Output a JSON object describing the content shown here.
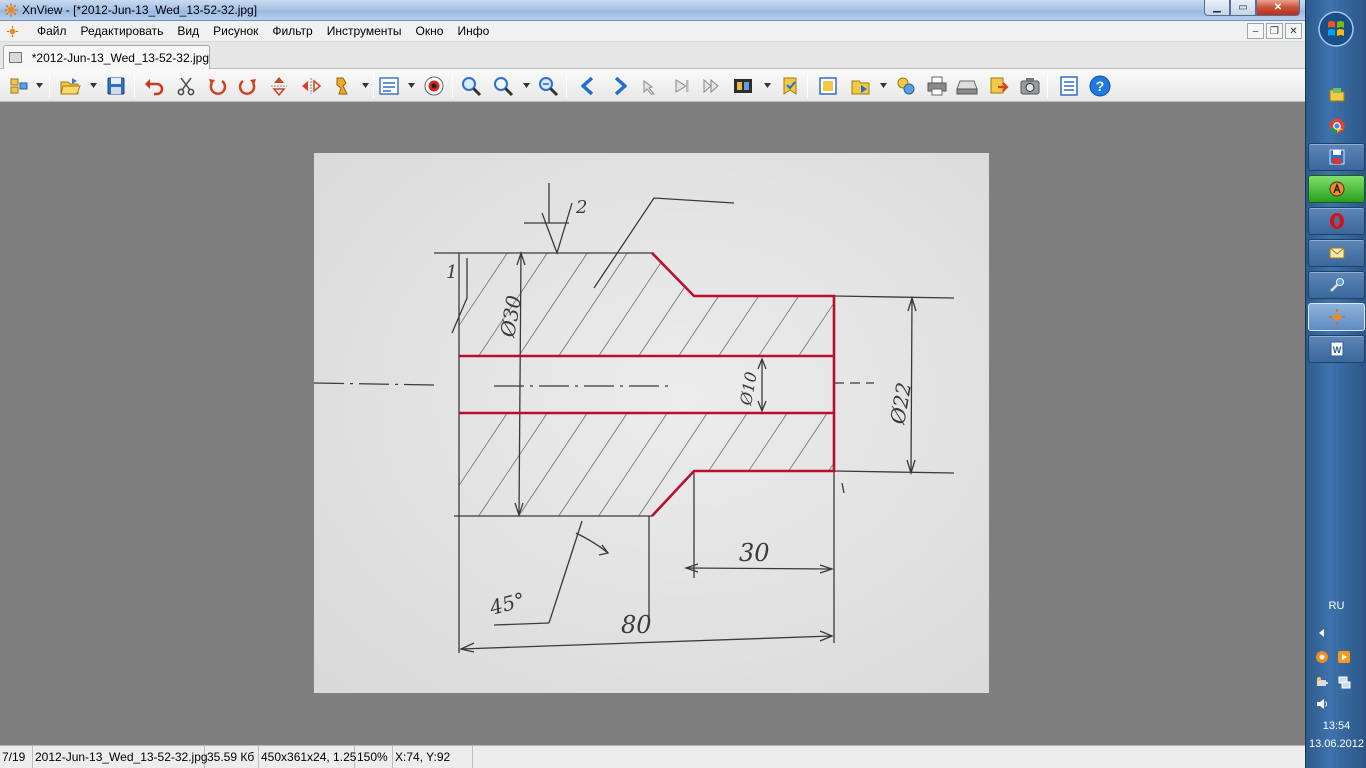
{
  "window": {
    "title": "XnView - [*2012-Jun-13_Wed_13-52-32.jpg]",
    "controls": {
      "minimize": "▁",
      "maximize": "▭",
      "close": "✕"
    }
  },
  "menu": {
    "items": [
      "Файл",
      "Редактировать",
      "Вид",
      "Рисунок",
      "Фильтр",
      "Инструменты",
      "Окно",
      "Инфо"
    ],
    "mdi": {
      "minimize": "–",
      "restore": "❐",
      "close": "✕"
    }
  },
  "tab": {
    "label": "*2012-Jun-13_Wed_13-52-32.jpg"
  },
  "toolbar": {
    "icons": [
      "browse-icon",
      "open-icon",
      "save-icon",
      "undo-icon",
      "cut-icon",
      "rotate-left-icon",
      "rotate-right-icon",
      "flip-vertical-icon",
      "flip-horizontal-icon",
      "adjust-icon",
      "properties-icon",
      "red-eye-icon",
      "zoom-in-icon",
      "zoom-icon",
      "zoom-out-icon",
      "previous-icon",
      "next-icon",
      "first-icon",
      "last-icon",
      "slideshow-icon",
      "filmstrip-icon",
      "tag-icon",
      "new-icon",
      "open-folder-icon",
      "batch-icon",
      "print-icon",
      "scan-icon",
      "export-icon",
      "capture-icon",
      "settings-icon",
      "help-icon"
    ]
  },
  "drawing": {
    "labels": [
      "2",
      "1",
      "Ø30",
      "Ø10",
      "Ø22",
      "30",
      "45°",
      "80"
    ]
  },
  "status": {
    "index": "7/19",
    "filename": "2012-Jun-13_Wed_13-52-32.jpg",
    "filesize": "35.59 Кб",
    "dimensions": "450x361x24, 1.25",
    "zoom": "150%",
    "coords": "X:74, Y:92"
  },
  "taskbar": {
    "apps": [
      "explorer-icon",
      "chrome-icon",
      "floppy-icon",
      "avast-icon",
      "opera-icon",
      "mail-icon",
      "tools-icon",
      "xnview-icon",
      "word-icon"
    ],
    "language": "RU",
    "time": "13:54",
    "date": "13.06.2012"
  },
  "colors": {
    "accent": "#3e73ad",
    "drawing_red": "#b8102a",
    "pencil": "#3a3a3a"
  }
}
